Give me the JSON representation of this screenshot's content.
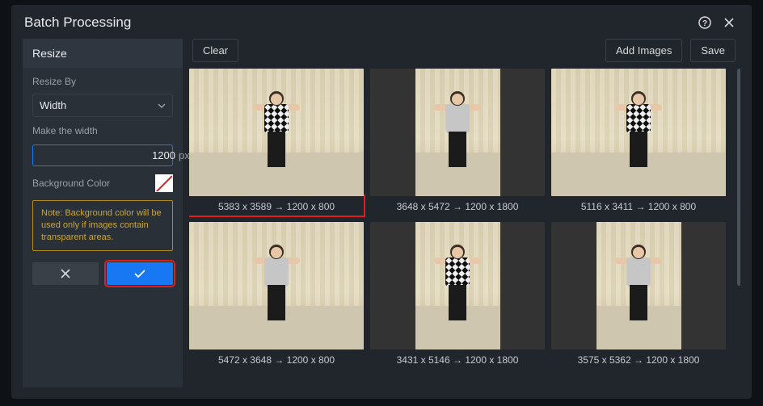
{
  "title": "Batch Processing",
  "sidebar": {
    "header": "Resize",
    "resize_by_label": "Resize By",
    "resize_by_value": "Width",
    "make_width_label": "Make the width",
    "width_value": "1200",
    "unit": "px",
    "bg_color_label": "Background Color",
    "note": "Note: Background color will be used only if images contain transparent areas."
  },
  "toolbar": {
    "clear": "Clear",
    "add_images": "Add Images",
    "save": "Save"
  },
  "images": [
    {
      "orig": "5383 x 3589",
      "new": "1200 x 800",
      "ratio": 1.5,
      "highlighted": true
    },
    {
      "orig": "3648 x 5472",
      "new": "1200 x 1800",
      "ratio": 0.667
    },
    {
      "orig": "5116 x 3411",
      "new": "1200 x 800",
      "ratio": 1.5
    },
    {
      "orig": "5472 x 3648",
      "new": "1200 x 800",
      "ratio": 1.5
    },
    {
      "orig": "3431 x 5146",
      "new": "1200 x 1800",
      "ratio": 0.667
    },
    {
      "orig": "3575 x 5362",
      "new": "1200 x 1800",
      "ratio": 0.667
    }
  ],
  "arrow": "→"
}
